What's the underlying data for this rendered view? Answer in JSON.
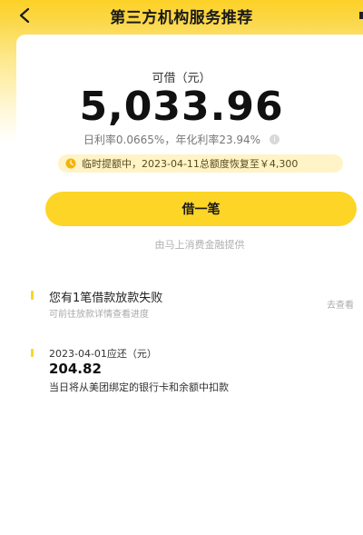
{
  "header": {
    "title": "第三方机构服务推荐",
    "back_icon": "chevron-left-icon"
  },
  "loan": {
    "available_label": "可借（元）",
    "amount": "5,033.96",
    "daily_rate_text": "日利率0.0665%，年化利率23.94%",
    "notice_text": "临时提额中，2023-04-11总额度恢复至￥4,300",
    "borrow_button": "借一笔",
    "provider_text": "由马上消费金融提供"
  },
  "failure_notice": {
    "title": "您有1笔借款放款失败",
    "subtitle": "可前往放款详情查看进度",
    "link": "去查看"
  },
  "repayment": {
    "date_label": "2023-04-01应还（元）",
    "amount": "204.82",
    "description": "当日将从美团绑定的银行卡和余额中扣款"
  },
  "colors": {
    "brand_yellow": "#fcd527",
    "notice_bg": "#fff4c7"
  }
}
